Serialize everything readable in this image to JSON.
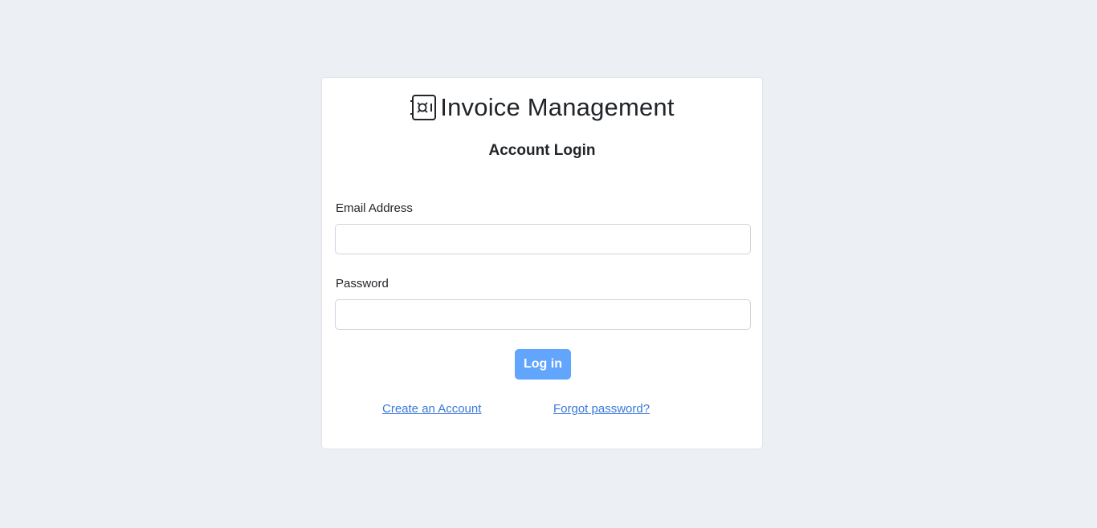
{
  "brand": {
    "title": "Invoice Management",
    "icon": "safe-icon"
  },
  "form": {
    "heading": "Account Login",
    "email_label": "Email Address",
    "email_value": "",
    "password_label": "Password",
    "password_value": "",
    "submit_label": "Log in"
  },
  "links": {
    "create_account": "Create an Account",
    "forgot_password": "Forgot password?"
  },
  "colors": {
    "background": "#ecf0f4",
    "card": "#ffffff",
    "button": "#62a5fd",
    "link": "#3a78d8",
    "text": "#212529"
  }
}
